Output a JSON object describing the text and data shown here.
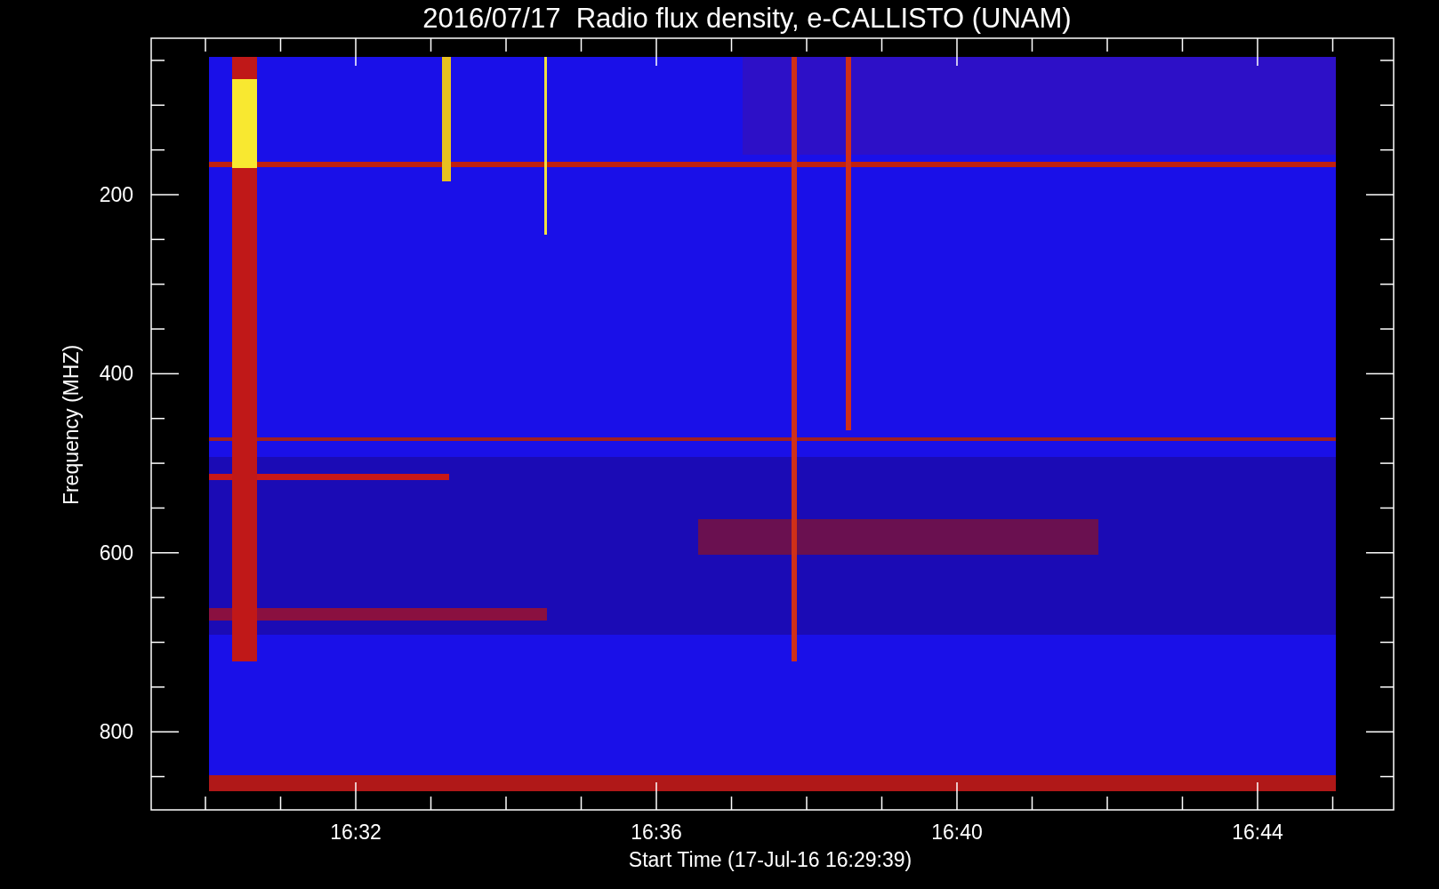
{
  "title": "2016/07/17  Radio flux density, e-CALLISTO (UNAM)",
  "y_axis": {
    "label": "Frequency (MHZ)",
    "ticks": [
      "200",
      "400",
      "600",
      "800"
    ]
  },
  "x_axis": {
    "label": "Start Time (17-Jul-16 16:29:39)",
    "ticks": [
      "16:32",
      "16:36",
      "16:40",
      "16:44"
    ]
  }
}
